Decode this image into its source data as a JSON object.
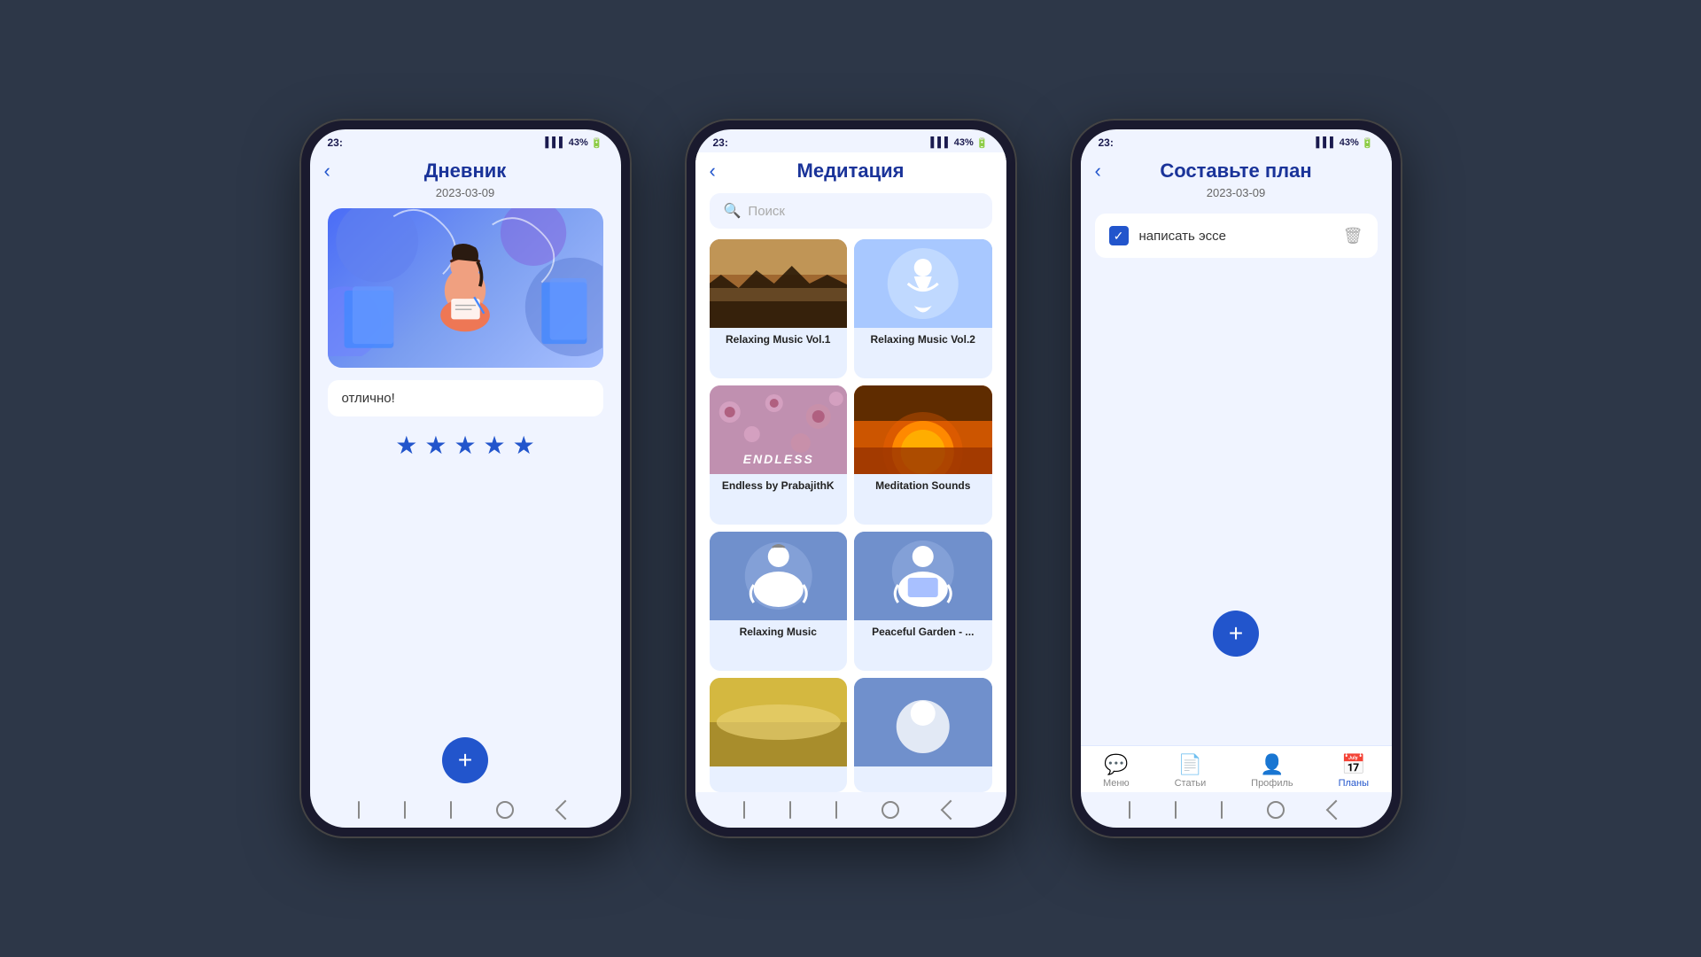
{
  "phone1": {
    "statusTime": "23:",
    "statusIcons": "all 43%",
    "title": "Дневник",
    "date": "2023-03-09",
    "entryText": "отлично!",
    "stars": 5,
    "addBtnLabel": "+"
  },
  "phone2": {
    "statusTime": "23:",
    "statusIcons": "all 43%",
    "title": "Медитация",
    "searchPlaceholder": "Поиск",
    "musicCards": [
      {
        "label": "Relaxing Music Vol.1",
        "thumbClass": "thumb-rm1"
      },
      {
        "label": "Relaxing Music Vol.2",
        "thumbClass": "thumb-rm2"
      },
      {
        "label": "Endless by PrabajithK",
        "thumbClass": "thumb-endless"
      },
      {
        "label": "Meditation Sounds",
        "thumbClass": "thumb-ms"
      },
      {
        "label": "Relaxing Music",
        "thumbClass": "thumb-rm3"
      },
      {
        "label": "Peaceful Garden - ...",
        "thumbClass": "thumb-pg"
      },
      {
        "label": "",
        "thumbClass": "thumb-bottom1"
      },
      {
        "label": "",
        "thumbClass": "thumb-bottom2"
      }
    ]
  },
  "phone3": {
    "statusTime": "23:",
    "statusIcons": "all 43%",
    "title": "Составьте план",
    "date": "2023-03-09",
    "planItem": "написать эссе",
    "addBtnLabel": "+",
    "navItems": [
      {
        "label": "Меню",
        "icon": "💬",
        "active": false
      },
      {
        "label": "Статьи",
        "icon": "📄",
        "active": false
      },
      {
        "label": "Профиль",
        "icon": "👤",
        "active": false
      },
      {
        "label": "Планы",
        "icon": "📅",
        "active": true
      }
    ]
  }
}
